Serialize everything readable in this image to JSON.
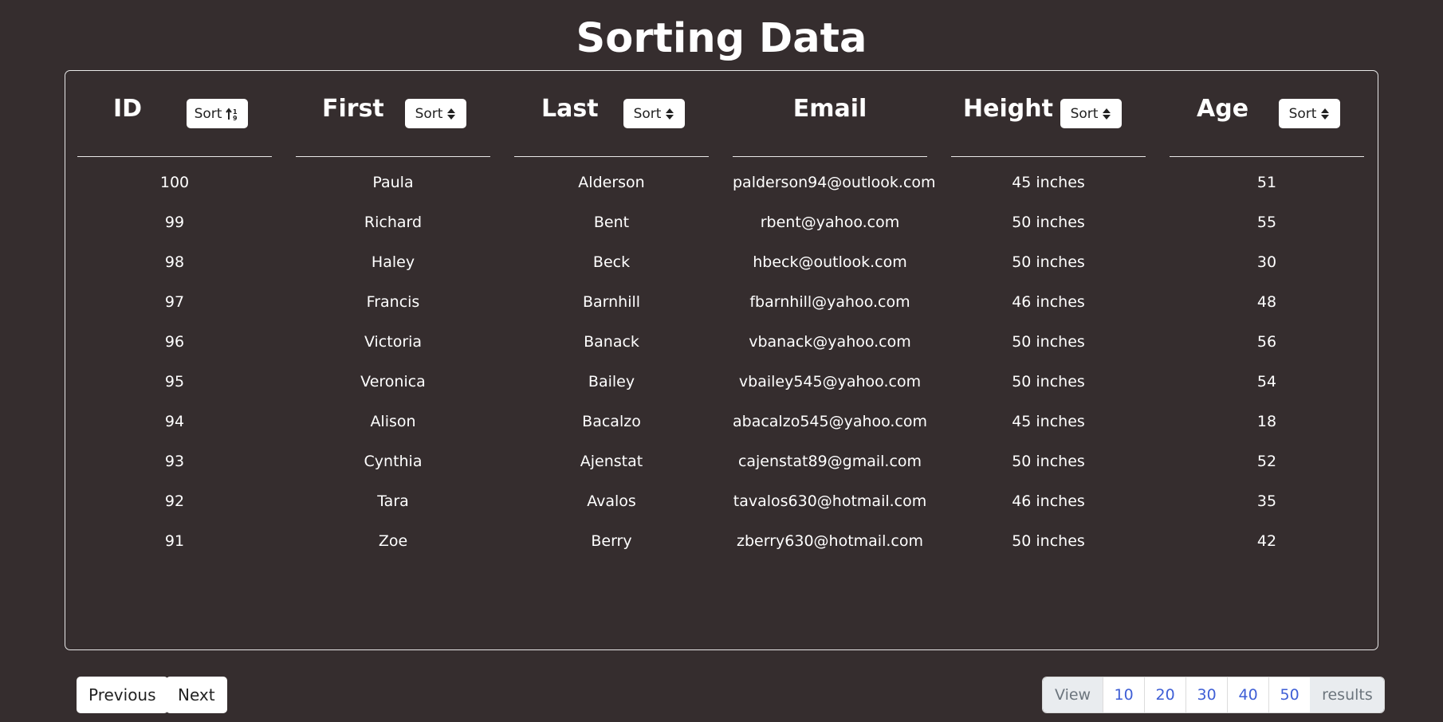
{
  "page": {
    "title": "Sorting Data"
  },
  "columns": [
    {
      "key": "id",
      "label": "ID",
      "sortable": true,
      "sort_label": "Sort",
      "sort_state": "asc-active"
    },
    {
      "key": "first",
      "label": "First",
      "sortable": true,
      "sort_label": "Sort",
      "sort_state": "none"
    },
    {
      "key": "last",
      "label": "Last",
      "sortable": true,
      "sort_label": "Sort",
      "sort_state": "none"
    },
    {
      "key": "email",
      "label": "Email",
      "sortable": false
    },
    {
      "key": "height",
      "label": "Height",
      "sortable": true,
      "sort_label": "Sort",
      "sort_state": "none"
    },
    {
      "key": "age",
      "label": "Age",
      "sortable": true,
      "sort_label": "Sort",
      "sort_state": "none"
    }
  ],
  "rows": [
    {
      "id": "100",
      "first": "Paula",
      "last": "Alderson",
      "email": "palderson94@outlook.com",
      "height": "45 inches",
      "age": "51"
    },
    {
      "id": "99",
      "first": "Richard",
      "last": "Bent",
      "email": "rbent@yahoo.com",
      "height": "50 inches",
      "age": "55"
    },
    {
      "id": "98",
      "first": "Haley",
      "last": "Beck",
      "email": "hbeck@outlook.com",
      "height": "50 inches",
      "age": "30"
    },
    {
      "id": "97",
      "first": "Francis",
      "last": "Barnhill",
      "email": "fbarnhill@yahoo.com",
      "height": "46 inches",
      "age": "48"
    },
    {
      "id": "96",
      "first": "Victoria",
      "last": "Banack",
      "email": "vbanack@yahoo.com",
      "height": "50 inches",
      "age": "56"
    },
    {
      "id": "95",
      "first": "Veronica",
      "last": "Bailey",
      "email": "vbailey545@yahoo.com",
      "height": "50 inches",
      "age": "54"
    },
    {
      "id": "94",
      "first": "Alison",
      "last": "Bacalzo",
      "email": "abacalzo545@yahoo.com",
      "height": "45 inches",
      "age": "18"
    },
    {
      "id": "93",
      "first": "Cynthia",
      "last": "Ajenstat",
      "email": "cajenstat89@gmail.com",
      "height": "50 inches",
      "age": "52"
    },
    {
      "id": "92",
      "first": "Tara",
      "last": "Avalos",
      "email": "tavalos630@hotmail.com",
      "height": "46 inches",
      "age": "35"
    },
    {
      "id": "91",
      "first": "Zoe",
      "last": "Berry",
      "email": "zberry630@hotmail.com",
      "height": "50 inches",
      "age": "42"
    }
  ],
  "pagination": {
    "previous_label": "Previous",
    "next_label": "Next"
  },
  "page_size": {
    "prefix": "View",
    "options": [
      "10",
      "20",
      "30",
      "40",
      "50"
    ],
    "suffix": "results"
  },
  "colors": {
    "background": "#352d2e",
    "text": "#ffffff",
    "link": "#3f5fd6",
    "addon_background": "#e9ecef"
  }
}
